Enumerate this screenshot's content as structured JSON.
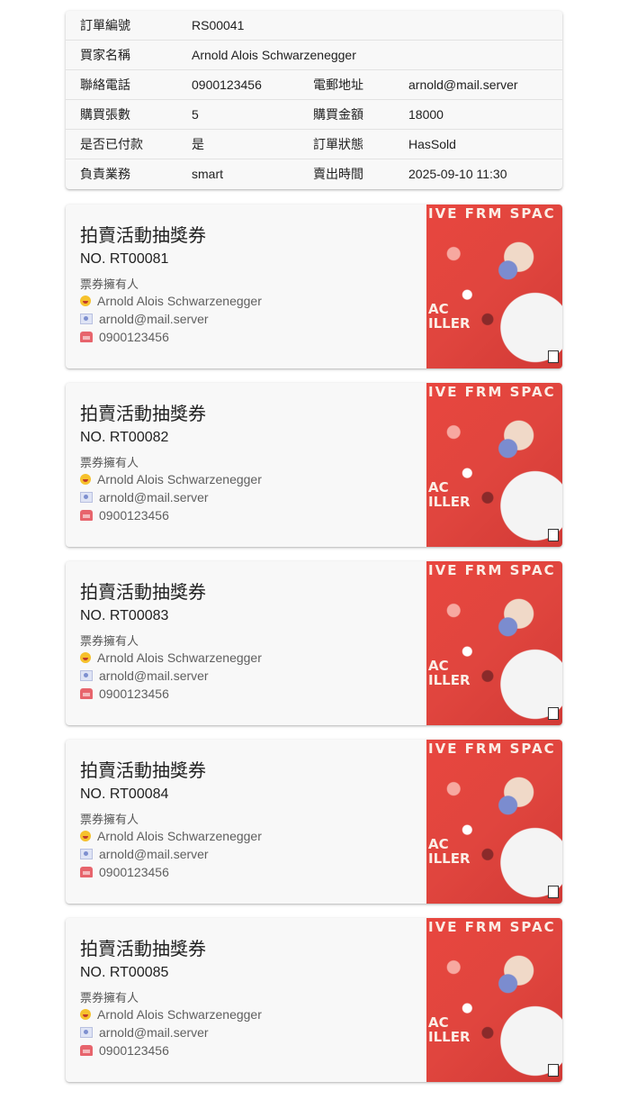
{
  "order": {
    "rows": [
      {
        "l1": "訂單編號",
        "v1": "RS00041",
        "l2": "",
        "v2": ""
      },
      {
        "l1": "買家名稱",
        "v1": "Arnold Alois Schwarzenegger",
        "l2": "",
        "v2": ""
      },
      {
        "l1": "聯絡電話",
        "v1": "0900123456",
        "l2": "電郵地址",
        "v2": "arnold@mail.server"
      },
      {
        "l1": "購買張數",
        "v1": "5",
        "l2": "購買金額",
        "v2": "18000"
      },
      {
        "l1": "是否已付款",
        "v1": "是",
        "l2": "訂單狀態",
        "v2": "HasSold"
      },
      {
        "l1": "負責業務",
        "v1": "smart",
        "l2": "賣出時間",
        "v2": "2025-09-10 11:30"
      }
    ]
  },
  "tickets": [
    {
      "title": "拍賣活動抽獎券",
      "no": "NO. RT00081",
      "owner_label": "票券擁有人",
      "name": "Arnold Alois Schwarzenegger",
      "email": "arnold@mail.server",
      "phone": "0900123456",
      "poster_top": "IVE FRM SPAC",
      "poster_bottom": "AC\nILLER"
    },
    {
      "title": "拍賣活動抽獎券",
      "no": "NO. RT00082",
      "owner_label": "票券擁有人",
      "name": "Arnold Alois Schwarzenegger",
      "email": "arnold@mail.server",
      "phone": "0900123456",
      "poster_top": "IVE FRM SPAC",
      "poster_bottom": "AC\nILLER"
    },
    {
      "title": "拍賣活動抽獎券",
      "no": "NO. RT00083",
      "owner_label": "票券擁有人",
      "name": "Arnold Alois Schwarzenegger",
      "email": "arnold@mail.server",
      "phone": "0900123456",
      "poster_top": "IVE FRM SPAC",
      "poster_bottom": "AC\nILLER"
    },
    {
      "title": "拍賣活動抽獎券",
      "no": "NO. RT00084",
      "owner_label": "票券擁有人",
      "name": "Arnold Alois Schwarzenegger",
      "email": "arnold@mail.server",
      "phone": "0900123456",
      "poster_top": "IVE FRM SPAC",
      "poster_bottom": "AC\nILLER"
    },
    {
      "title": "拍賣活動抽獎券",
      "no": "NO. RT00085",
      "owner_label": "票券擁有人",
      "name": "Arnold Alois Schwarzenegger",
      "email": "arnold@mail.server",
      "phone": "0900123456",
      "poster_top": "IVE FRM SPAC",
      "poster_bottom": "AC\nILLER"
    }
  ],
  "icons": {
    "name": "grinning-face-icon",
    "email": "envelope-icon",
    "phone": "telephone-icon"
  }
}
